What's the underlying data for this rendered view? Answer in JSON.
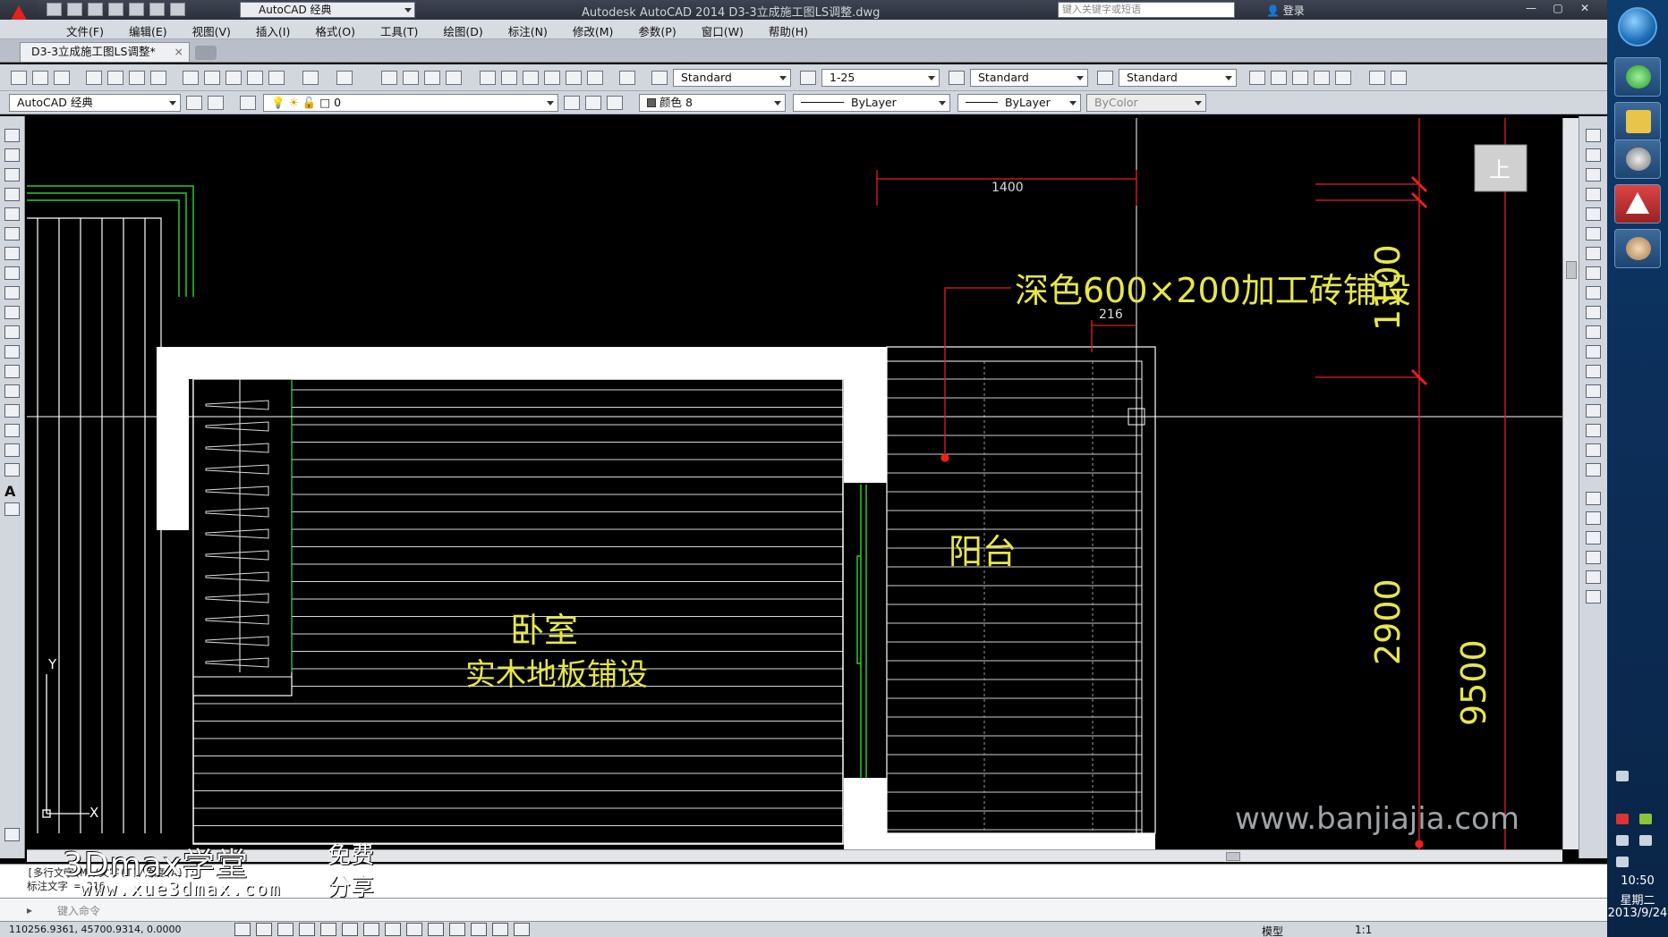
{
  "app": {
    "title": "Autodesk AutoCAD 2014    D3-3立成施工图LS调整.dwg",
    "workspace": "AutoCAD 经典",
    "search_placeholder": "键入关键字或短语",
    "login": "登录"
  },
  "menu": [
    "文件(F)",
    "编辑(E)",
    "视图(V)",
    "插入(I)",
    "格式(O)",
    "工具(T)",
    "绘图(D)",
    "标注(N)",
    "修改(M)",
    "参数(P)",
    "窗口(W)",
    "帮助(H)"
  ],
  "doc_tab": {
    "label": "D3-3立成施工图LS调整*",
    "close": "×"
  },
  "toolbar1": {
    "text_style": "Standard",
    "dim_scale": "1-25",
    "table_style": "Standard",
    "mleader_style": "Standard"
  },
  "toolbar2": {
    "workspace": "AutoCAD 经典",
    "layer": "0",
    "color": "颜色 8",
    "linetype": "ByLayer",
    "lineweight": "ByLayer",
    "plotstyle": "ByColor"
  },
  "drawing": {
    "dim_1400": "1400",
    "dim_216": "216",
    "dim_1100": "1100",
    "dim_2900": "2900",
    "dim_9500": "9500",
    "note_tile": "深色600×200加工砖铺设",
    "room_balcony": "阳台",
    "room_bedroom": "卧室",
    "bedroom_floor": "实木地板铺设",
    "view_cube": "上",
    "ucs_y": "Y",
    "ucs_x": "X",
    "colors": {
      "red": "#e8201e",
      "yellow": "#e6e64a",
      "green": "#2ec82e",
      "white": "#ffffff",
      "grey": "#9a9a9a"
    }
  },
  "command": {
    "history_1": "[多行文字(M)/文字(T)/角度(A)]:",
    "history_2": "标注文字 = 216",
    "prompt": "键入命令"
  },
  "status": {
    "coords": "110256.9361, 45700.9314, 0.0000",
    "model": "模型",
    "scale": "1:1"
  },
  "watermark": {
    "brand": "3Dmax学堂",
    "free": "免费",
    "share": "分享",
    "url": "www.xue3dmax.com",
    "site": "www.banjiajia.com"
  },
  "taskbar": {
    "time": "10:50",
    "weekday": "星期二",
    "date": "2013/9/24"
  }
}
